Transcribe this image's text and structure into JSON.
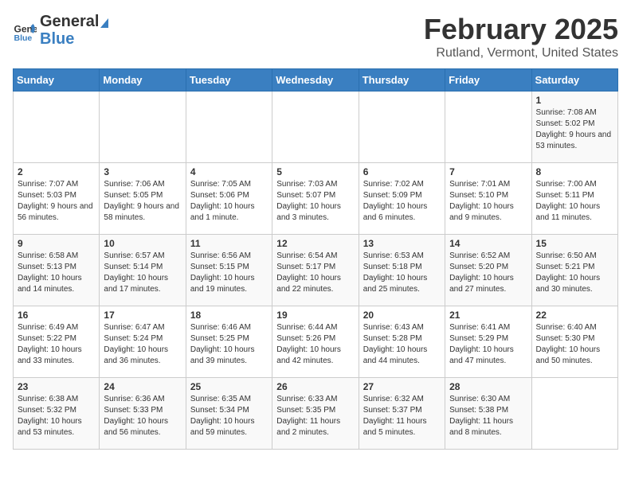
{
  "header": {
    "logo_general": "General",
    "logo_blue": "Blue",
    "title": "February 2025",
    "subtitle": "Rutland, Vermont, United States"
  },
  "days_of_week": [
    "Sunday",
    "Monday",
    "Tuesday",
    "Wednesday",
    "Thursday",
    "Friday",
    "Saturday"
  ],
  "weeks": [
    [
      {
        "day": "",
        "info": ""
      },
      {
        "day": "",
        "info": ""
      },
      {
        "day": "",
        "info": ""
      },
      {
        "day": "",
        "info": ""
      },
      {
        "day": "",
        "info": ""
      },
      {
        "day": "",
        "info": ""
      },
      {
        "day": "1",
        "info": "Sunrise: 7:08 AM\nSunset: 5:02 PM\nDaylight: 9 hours and 53 minutes."
      }
    ],
    [
      {
        "day": "2",
        "info": "Sunrise: 7:07 AM\nSunset: 5:03 PM\nDaylight: 9 hours and 56 minutes."
      },
      {
        "day": "3",
        "info": "Sunrise: 7:06 AM\nSunset: 5:05 PM\nDaylight: 9 hours and 58 minutes."
      },
      {
        "day": "4",
        "info": "Sunrise: 7:05 AM\nSunset: 5:06 PM\nDaylight: 10 hours and 1 minute."
      },
      {
        "day": "5",
        "info": "Sunrise: 7:03 AM\nSunset: 5:07 PM\nDaylight: 10 hours and 3 minutes."
      },
      {
        "day": "6",
        "info": "Sunrise: 7:02 AM\nSunset: 5:09 PM\nDaylight: 10 hours and 6 minutes."
      },
      {
        "day": "7",
        "info": "Sunrise: 7:01 AM\nSunset: 5:10 PM\nDaylight: 10 hours and 9 minutes."
      },
      {
        "day": "8",
        "info": "Sunrise: 7:00 AM\nSunset: 5:11 PM\nDaylight: 10 hours and 11 minutes."
      }
    ],
    [
      {
        "day": "9",
        "info": "Sunrise: 6:58 AM\nSunset: 5:13 PM\nDaylight: 10 hours and 14 minutes."
      },
      {
        "day": "10",
        "info": "Sunrise: 6:57 AM\nSunset: 5:14 PM\nDaylight: 10 hours and 17 minutes."
      },
      {
        "day": "11",
        "info": "Sunrise: 6:56 AM\nSunset: 5:15 PM\nDaylight: 10 hours and 19 minutes."
      },
      {
        "day": "12",
        "info": "Sunrise: 6:54 AM\nSunset: 5:17 PM\nDaylight: 10 hours and 22 minutes."
      },
      {
        "day": "13",
        "info": "Sunrise: 6:53 AM\nSunset: 5:18 PM\nDaylight: 10 hours and 25 minutes."
      },
      {
        "day": "14",
        "info": "Sunrise: 6:52 AM\nSunset: 5:20 PM\nDaylight: 10 hours and 27 minutes."
      },
      {
        "day": "15",
        "info": "Sunrise: 6:50 AM\nSunset: 5:21 PM\nDaylight: 10 hours and 30 minutes."
      }
    ],
    [
      {
        "day": "16",
        "info": "Sunrise: 6:49 AM\nSunset: 5:22 PM\nDaylight: 10 hours and 33 minutes."
      },
      {
        "day": "17",
        "info": "Sunrise: 6:47 AM\nSunset: 5:24 PM\nDaylight: 10 hours and 36 minutes."
      },
      {
        "day": "18",
        "info": "Sunrise: 6:46 AM\nSunset: 5:25 PM\nDaylight: 10 hours and 39 minutes."
      },
      {
        "day": "19",
        "info": "Sunrise: 6:44 AM\nSunset: 5:26 PM\nDaylight: 10 hours and 42 minutes."
      },
      {
        "day": "20",
        "info": "Sunrise: 6:43 AM\nSunset: 5:28 PM\nDaylight: 10 hours and 44 minutes."
      },
      {
        "day": "21",
        "info": "Sunrise: 6:41 AM\nSunset: 5:29 PM\nDaylight: 10 hours and 47 minutes."
      },
      {
        "day": "22",
        "info": "Sunrise: 6:40 AM\nSunset: 5:30 PM\nDaylight: 10 hours and 50 minutes."
      }
    ],
    [
      {
        "day": "23",
        "info": "Sunrise: 6:38 AM\nSunset: 5:32 PM\nDaylight: 10 hours and 53 minutes."
      },
      {
        "day": "24",
        "info": "Sunrise: 6:36 AM\nSunset: 5:33 PM\nDaylight: 10 hours and 56 minutes."
      },
      {
        "day": "25",
        "info": "Sunrise: 6:35 AM\nSunset: 5:34 PM\nDaylight: 10 hours and 59 minutes."
      },
      {
        "day": "26",
        "info": "Sunrise: 6:33 AM\nSunset: 5:35 PM\nDaylight: 11 hours and 2 minutes."
      },
      {
        "day": "27",
        "info": "Sunrise: 6:32 AM\nSunset: 5:37 PM\nDaylight: 11 hours and 5 minutes."
      },
      {
        "day": "28",
        "info": "Sunrise: 6:30 AM\nSunset: 5:38 PM\nDaylight: 11 hours and 8 minutes."
      },
      {
        "day": "",
        "info": ""
      }
    ]
  ],
  "colors": {
    "header_bg": "#3a7fc1",
    "header_text": "#ffffff",
    "odd_row_bg": "#f9f9f9",
    "even_row_bg": "#ffffff"
  }
}
